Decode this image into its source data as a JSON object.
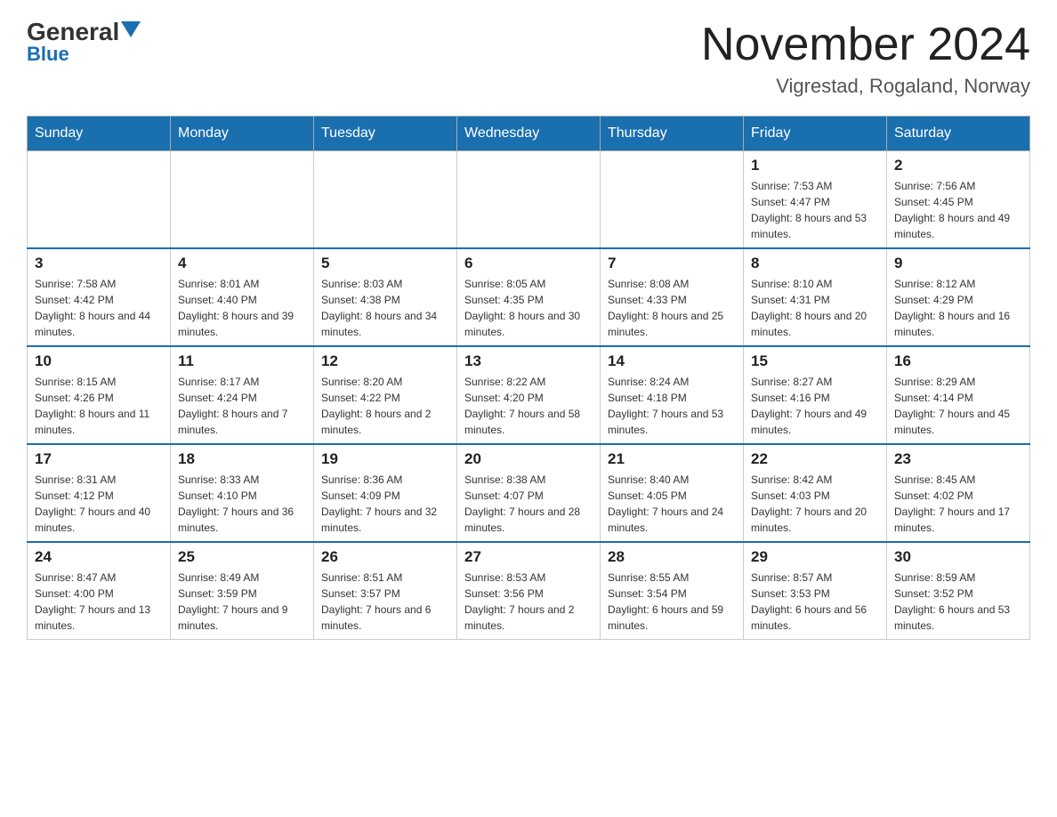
{
  "header": {
    "logo_text": "General",
    "logo_blue": "Blue",
    "title": "November 2024",
    "subtitle": "Vigrestad, Rogaland, Norway"
  },
  "days_of_week": [
    "Sunday",
    "Monday",
    "Tuesday",
    "Wednesday",
    "Thursday",
    "Friday",
    "Saturday"
  ],
  "weeks": [
    [
      {
        "day": "",
        "info": ""
      },
      {
        "day": "",
        "info": ""
      },
      {
        "day": "",
        "info": ""
      },
      {
        "day": "",
        "info": ""
      },
      {
        "day": "",
        "info": ""
      },
      {
        "day": "1",
        "info": "Sunrise: 7:53 AM\nSunset: 4:47 PM\nDaylight: 8 hours and 53 minutes."
      },
      {
        "day": "2",
        "info": "Sunrise: 7:56 AM\nSunset: 4:45 PM\nDaylight: 8 hours and 49 minutes."
      }
    ],
    [
      {
        "day": "3",
        "info": "Sunrise: 7:58 AM\nSunset: 4:42 PM\nDaylight: 8 hours and 44 minutes."
      },
      {
        "day": "4",
        "info": "Sunrise: 8:01 AM\nSunset: 4:40 PM\nDaylight: 8 hours and 39 minutes."
      },
      {
        "day": "5",
        "info": "Sunrise: 8:03 AM\nSunset: 4:38 PM\nDaylight: 8 hours and 34 minutes."
      },
      {
        "day": "6",
        "info": "Sunrise: 8:05 AM\nSunset: 4:35 PM\nDaylight: 8 hours and 30 minutes."
      },
      {
        "day": "7",
        "info": "Sunrise: 8:08 AM\nSunset: 4:33 PM\nDaylight: 8 hours and 25 minutes."
      },
      {
        "day": "8",
        "info": "Sunrise: 8:10 AM\nSunset: 4:31 PM\nDaylight: 8 hours and 20 minutes."
      },
      {
        "day": "9",
        "info": "Sunrise: 8:12 AM\nSunset: 4:29 PM\nDaylight: 8 hours and 16 minutes."
      }
    ],
    [
      {
        "day": "10",
        "info": "Sunrise: 8:15 AM\nSunset: 4:26 PM\nDaylight: 8 hours and 11 minutes."
      },
      {
        "day": "11",
        "info": "Sunrise: 8:17 AM\nSunset: 4:24 PM\nDaylight: 8 hours and 7 minutes."
      },
      {
        "day": "12",
        "info": "Sunrise: 8:20 AM\nSunset: 4:22 PM\nDaylight: 8 hours and 2 minutes."
      },
      {
        "day": "13",
        "info": "Sunrise: 8:22 AM\nSunset: 4:20 PM\nDaylight: 7 hours and 58 minutes."
      },
      {
        "day": "14",
        "info": "Sunrise: 8:24 AM\nSunset: 4:18 PM\nDaylight: 7 hours and 53 minutes."
      },
      {
        "day": "15",
        "info": "Sunrise: 8:27 AM\nSunset: 4:16 PM\nDaylight: 7 hours and 49 minutes."
      },
      {
        "day": "16",
        "info": "Sunrise: 8:29 AM\nSunset: 4:14 PM\nDaylight: 7 hours and 45 minutes."
      }
    ],
    [
      {
        "day": "17",
        "info": "Sunrise: 8:31 AM\nSunset: 4:12 PM\nDaylight: 7 hours and 40 minutes."
      },
      {
        "day": "18",
        "info": "Sunrise: 8:33 AM\nSunset: 4:10 PM\nDaylight: 7 hours and 36 minutes."
      },
      {
        "day": "19",
        "info": "Sunrise: 8:36 AM\nSunset: 4:09 PM\nDaylight: 7 hours and 32 minutes."
      },
      {
        "day": "20",
        "info": "Sunrise: 8:38 AM\nSunset: 4:07 PM\nDaylight: 7 hours and 28 minutes."
      },
      {
        "day": "21",
        "info": "Sunrise: 8:40 AM\nSunset: 4:05 PM\nDaylight: 7 hours and 24 minutes."
      },
      {
        "day": "22",
        "info": "Sunrise: 8:42 AM\nSunset: 4:03 PM\nDaylight: 7 hours and 20 minutes."
      },
      {
        "day": "23",
        "info": "Sunrise: 8:45 AM\nSunset: 4:02 PM\nDaylight: 7 hours and 17 minutes."
      }
    ],
    [
      {
        "day": "24",
        "info": "Sunrise: 8:47 AM\nSunset: 4:00 PM\nDaylight: 7 hours and 13 minutes."
      },
      {
        "day": "25",
        "info": "Sunrise: 8:49 AM\nSunset: 3:59 PM\nDaylight: 7 hours and 9 minutes."
      },
      {
        "day": "26",
        "info": "Sunrise: 8:51 AM\nSunset: 3:57 PM\nDaylight: 7 hours and 6 minutes."
      },
      {
        "day": "27",
        "info": "Sunrise: 8:53 AM\nSunset: 3:56 PM\nDaylight: 7 hours and 2 minutes."
      },
      {
        "day": "28",
        "info": "Sunrise: 8:55 AM\nSunset: 3:54 PM\nDaylight: 6 hours and 59 minutes."
      },
      {
        "day": "29",
        "info": "Sunrise: 8:57 AM\nSunset: 3:53 PM\nDaylight: 6 hours and 56 minutes."
      },
      {
        "day": "30",
        "info": "Sunrise: 8:59 AM\nSunset: 3:52 PM\nDaylight: 6 hours and 53 minutes."
      }
    ]
  ]
}
